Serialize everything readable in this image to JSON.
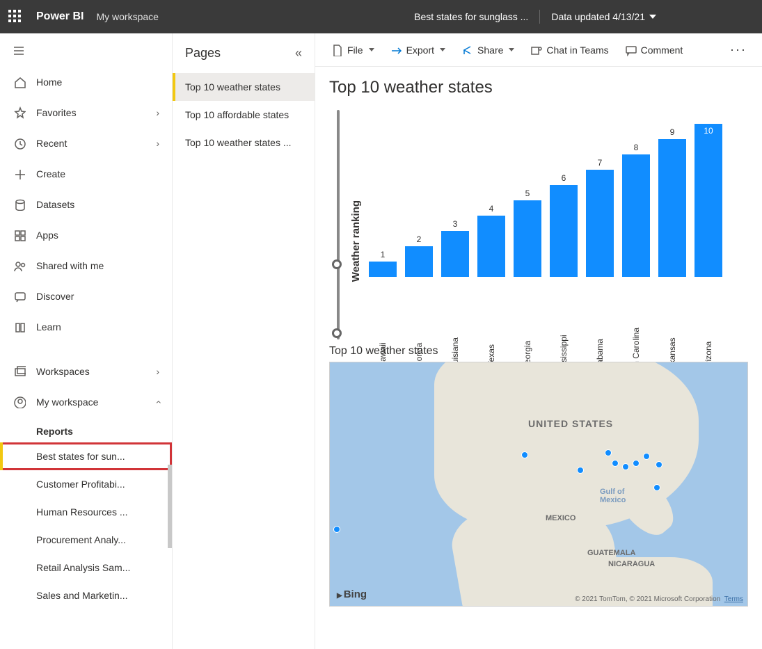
{
  "header": {
    "brand": "Power BI",
    "workspace": "My workspace",
    "report_name": "Best states for sunglass ...",
    "data_updated": "Data updated 4/13/21"
  },
  "leftnav": {
    "items": [
      {
        "label": "Home",
        "icon": "home"
      },
      {
        "label": "Favorites",
        "icon": "star",
        "chev": true
      },
      {
        "label": "Recent",
        "icon": "clock",
        "chev": true
      },
      {
        "label": "Create",
        "icon": "plus"
      },
      {
        "label": "Datasets",
        "icon": "db"
      },
      {
        "label": "Apps",
        "icon": "grid"
      },
      {
        "label": "Shared with me",
        "icon": "people"
      },
      {
        "label": "Discover",
        "icon": "chat"
      },
      {
        "label": "Learn",
        "icon": "book"
      }
    ],
    "workspaces_label": "Workspaces",
    "myworkspace_label": "My workspace",
    "reports_header": "Reports",
    "reports": [
      {
        "label": "Best states for sun...",
        "active": true,
        "highlighted": true
      },
      {
        "label": "Customer Profitabi..."
      },
      {
        "label": "Human Resources ..."
      },
      {
        "label": "Procurement Analy..."
      },
      {
        "label": "Retail Analysis Sam..."
      },
      {
        "label": "Sales and Marketin..."
      }
    ]
  },
  "pages": {
    "title": "Pages",
    "items": [
      {
        "label": "Top 10 weather states",
        "active": true
      },
      {
        "label": "Top 10 affordable states"
      },
      {
        "label": "Top 10 weather states ..."
      }
    ]
  },
  "toolbar": {
    "file": "File",
    "export": "Export",
    "share": "Share",
    "chat": "Chat in Teams",
    "comment": "Comment"
  },
  "chart_data": {
    "type": "bar",
    "title": "Top 10 weather states",
    "ylabel": "Weather ranking",
    "categories": [
      "Hawaii",
      "Florida",
      "Louisiana",
      "Texas",
      "Georgia",
      "Mississippi",
      "Alabama",
      "South Carolina",
      "Arkansas",
      "Arizona"
    ],
    "values": [
      1,
      2,
      3,
      4,
      5,
      6,
      7,
      8,
      9,
      10
    ],
    "ylim": [
      0,
      10
    ]
  },
  "map": {
    "title": "Top 10 weather states",
    "labels": {
      "us": "UNITED STATES",
      "mexico": "MEXICO",
      "gulf": "Gulf of Mexico",
      "guatemala": "GUATEMALA",
      "nicaragua": "NICARAGUA"
    },
    "bing": "Bing",
    "attr": "© 2021 TomTom, © 2021 Microsoft Corporation",
    "terms": "Terms"
  }
}
